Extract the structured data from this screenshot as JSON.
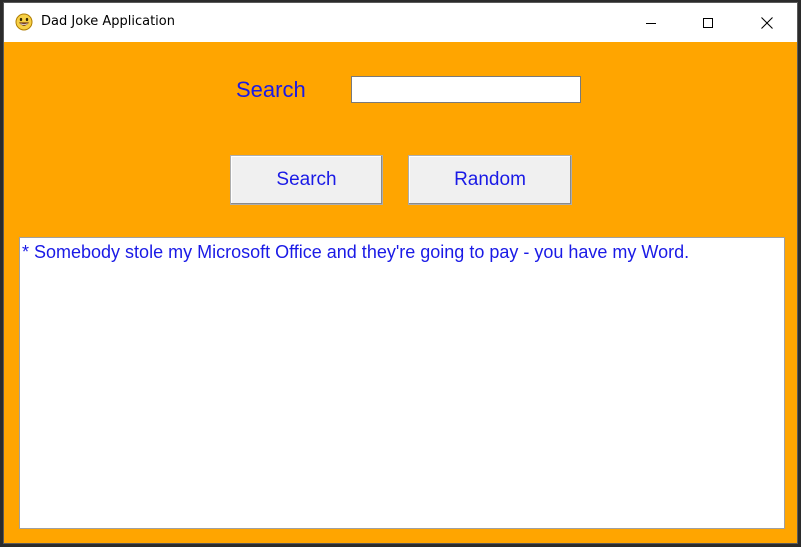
{
  "window": {
    "title": "Dad Joke Application",
    "icon": "grinning-face-icon"
  },
  "search": {
    "label": "Search",
    "value": "",
    "placeholder": ""
  },
  "buttons": {
    "search_label": "Search",
    "random_label": "Random"
  },
  "output": {
    "text": "* Somebody stole my Microsoft Office and they're going to pay - you have my Word."
  },
  "colors": {
    "background": "#ffa500",
    "text": "#1a1ae6",
    "button": "#f0f0f0"
  }
}
